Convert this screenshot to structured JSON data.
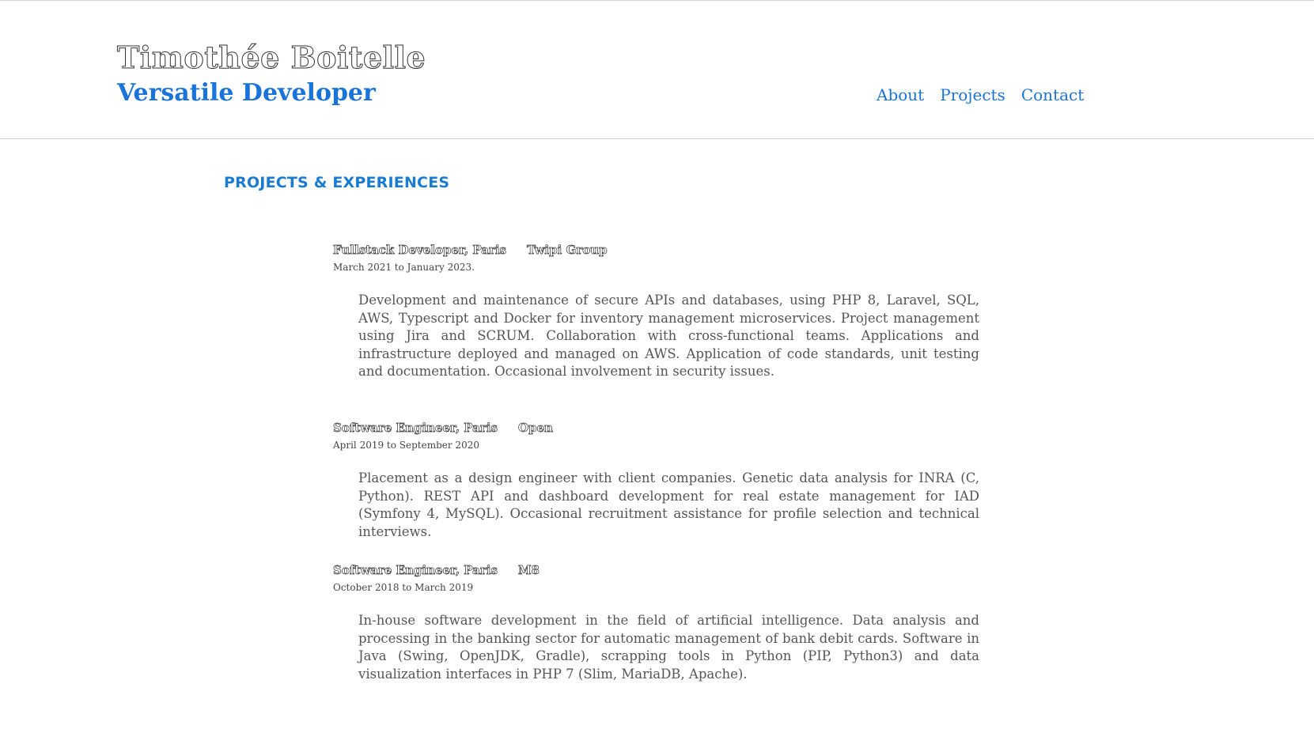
{
  "header": {
    "name": "Timothée Boitelle",
    "tagline": "Versatile Developer",
    "nav": [
      "About",
      "Projects",
      "Contact"
    ]
  },
  "section": {
    "title": "PROJECTS & EXPERIENCES"
  },
  "experiences": [
    {
      "role": "Fullstack Developer, Paris",
      "company": "Twipi Group",
      "dates": "March 2021 to January 2023.",
      "description": "Development and maintenance of secure APIs and databases, using PHP 8, Laravel, SQL, AWS, Typescript and Docker for inventory management microservices. Project management using Jira and SCRUM. Collaboration with cross-functional teams. Applications and infrastructure deployed and managed on AWS. Application of code standards, unit testing and documentation. Occasional involvement in security issues."
    },
    {
      "role": "Software Engineer, Paris",
      "company": "Open",
      "dates": "April 2019 to September 2020",
      "description": "Placement as a design engineer with client companies. Genetic data analysis for INRA (C, Python). REST API and dashboard development for real estate management for IAD (Symfony 4, MySQL). Occasional recruitment assistance for profile selection and technical interviews."
    },
    {
      "role": "Software Engineer, Paris",
      "company": "M8",
      "dates": "October 2018 to March 2019",
      "description": "In-house software development in the field of artificial intelligence. Data analysis and processing in the banking sector for automatic management of bank debit cards. Software in Java (Swing, OpenJDK, Gradle), scrapping tools in Python (PIP, Python3) and data visualization interfaces in PHP 7 (Slim, MariaDB, Apache)."
    }
  ]
}
